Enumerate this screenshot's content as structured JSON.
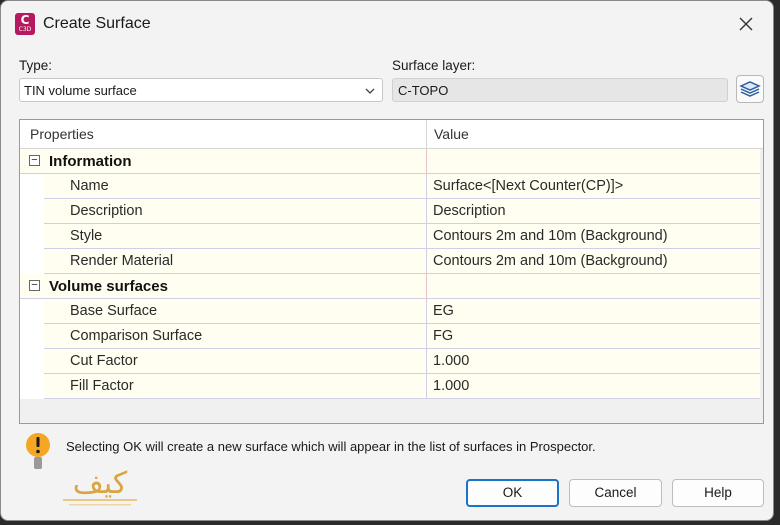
{
  "window": {
    "title": "Create Surface",
    "app_icon": {
      "letter": "C",
      "sub": "C3D",
      "color": "#b5195f"
    }
  },
  "form": {
    "type_label": "Type:",
    "type_value": "TIN volume surface",
    "surface_layer_label": "Surface layer:",
    "surface_layer_value": "C-TOPO"
  },
  "properties": {
    "headers": {
      "name": "Properties",
      "value": "Value"
    },
    "categories": [
      {
        "name": "Information",
        "collapse_symbol": "−",
        "rows": [
          {
            "name": "Name",
            "value": "Surface<[Next Counter(CP)]>"
          },
          {
            "name": "Description",
            "value": "Description"
          },
          {
            "name": "Style",
            "value": "Contours 2m and 10m (Background)"
          },
          {
            "name": "Render Material",
            "value": "Contours 2m and 10m (Background)"
          }
        ]
      },
      {
        "name": "Volume surfaces",
        "collapse_symbol": "−",
        "rows": [
          {
            "name": "Base Surface",
            "value": "EG"
          },
          {
            "name": "Comparison Surface",
            "value": "FG"
          },
          {
            "name": "Cut Factor",
            "value": "1.000"
          },
          {
            "name": "Fill Factor",
            "value": "1.000"
          }
        ]
      }
    ]
  },
  "message": "Selecting OK will create a new surface which will appear in the list of surfaces in Prospector.",
  "logo": {
    "text": "کیف",
    "color": "#d9a441"
  },
  "buttons": {
    "ok": "OK",
    "cancel": "Cancel",
    "help": "Help"
  },
  "colors": {
    "accent": "#1a73c8",
    "warning": "#f5a623",
    "grid_row": "#fffef0"
  }
}
